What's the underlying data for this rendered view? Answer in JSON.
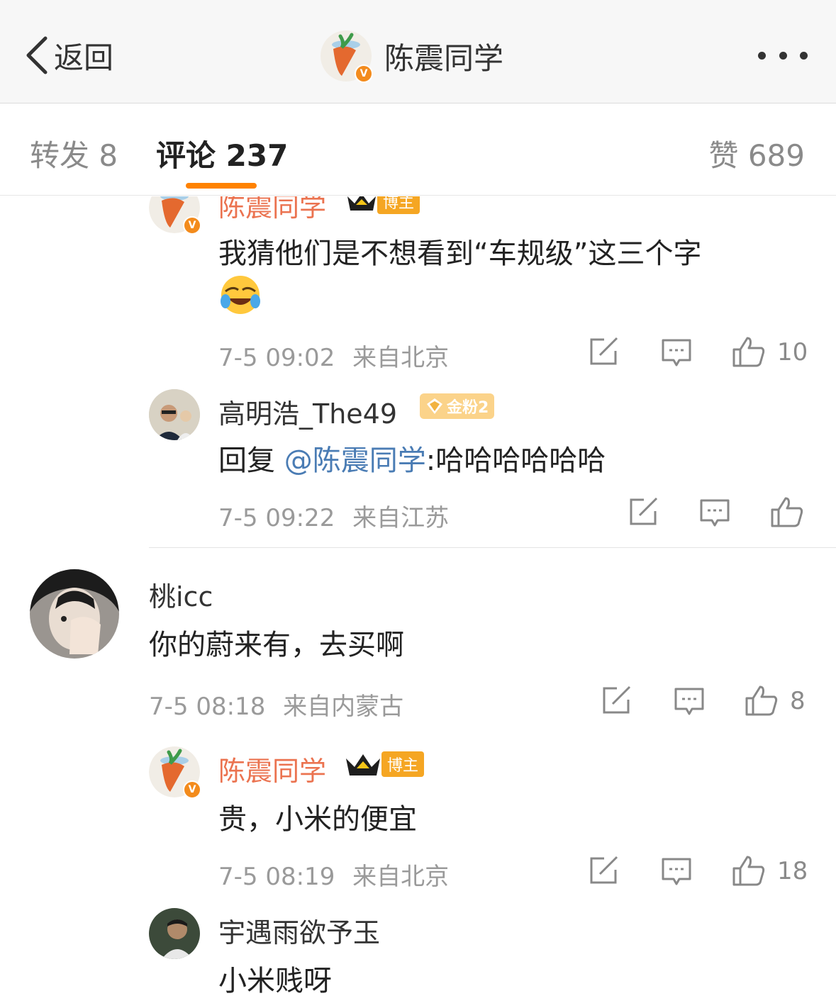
{
  "nav": {
    "back_label": "返回",
    "title": "陈震同学"
  },
  "tabs": {
    "repost": "转发 8",
    "comment": "评论 237",
    "like": "赞 689"
  },
  "comments": [
    {
      "name": "陈震同学",
      "badge": "博主",
      "text": "我猜他们是不想看到“车规级”这三个字",
      "emoji": "laugh-cry-emoji",
      "time": "7-5 09:02",
      "location": "来自北京",
      "likes": "10"
    },
    {
      "name": "高明浩_The49",
      "badge": "金粉2",
      "reply_prefix": "回复",
      "mention": "@陈震同学",
      "text": ":哈哈哈哈哈哈",
      "time": "7-5 09:22",
      "location": "来自江苏",
      "likes": ""
    },
    {
      "name": "桃icc",
      "text": "你的蔚来有，去买啊",
      "time": "7-5 08:18",
      "location": "来自内蒙古",
      "likes": "8"
    },
    {
      "name": "陈震同学",
      "badge": "博主",
      "text": "贵，小米的便宜",
      "time": "7-5 08:19",
      "location": "来自北京",
      "likes": "18"
    },
    {
      "name": "宇遇雨欲予玉",
      "text": "小米贱呀"
    }
  ],
  "colors": {
    "accent": "#ff8200",
    "name_host": "#eb7350",
    "mention": "#4a7cb4"
  }
}
